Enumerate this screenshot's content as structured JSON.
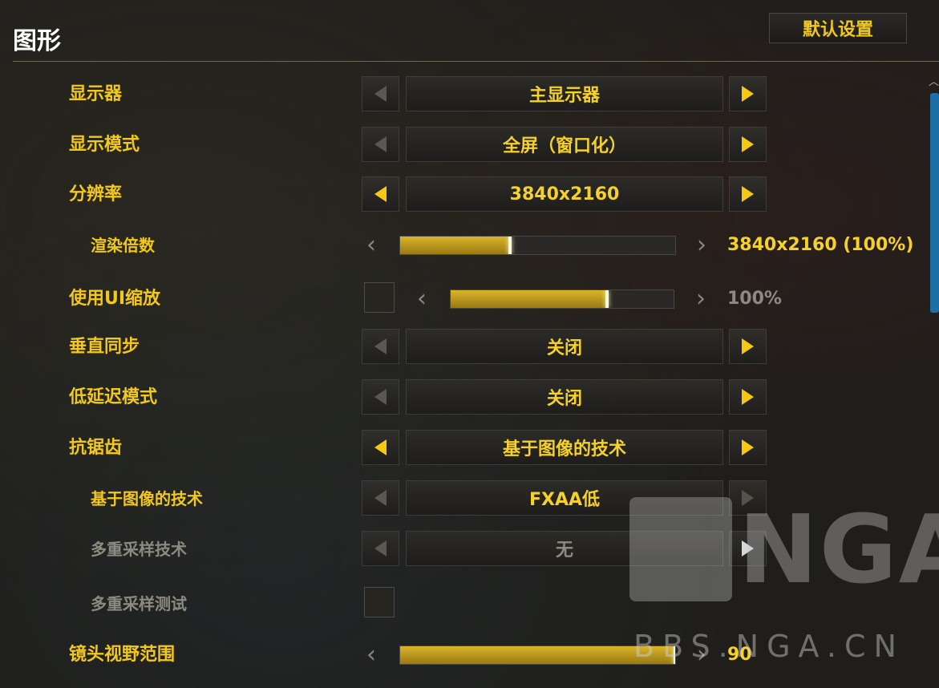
{
  "header": {
    "title": "图形",
    "default_button": "默认设置"
  },
  "settings": {
    "monitor": {
      "label": "显示器",
      "value": "主显示器"
    },
    "display_mode": {
      "label": "显示模式",
      "value": "全屏（窗口化）"
    },
    "resolution": {
      "label": "分辨率",
      "value": "3840x2160"
    },
    "render_scale": {
      "label": "渲染倍数",
      "value_text": "3840x2160 (100%)",
      "fill_fraction": 0.4
    },
    "ui_scale": {
      "label": "使用UI缩放",
      "value_text": "100%",
      "fill_fraction": 0.7,
      "checked": false
    },
    "vsync": {
      "label": "垂直同步",
      "value": "关闭"
    },
    "low_latency": {
      "label": "低延迟模式",
      "value": "关闭"
    },
    "anti_aliasing": {
      "label": "抗锯齿",
      "value": "基于图像的技术"
    },
    "image_based": {
      "label": "基于图像的技术",
      "value": "FXAA低"
    },
    "multisample": {
      "label": "多重采样技术",
      "value": "无"
    },
    "multisample_test": {
      "label": "多重采样测试",
      "checked": false
    },
    "fov": {
      "label": "镜头视野范围",
      "value_text": "90",
      "fill_fraction": 1.0
    }
  },
  "watermark": {
    "brand": "NGA",
    "url": "BBS.NGA.CN"
  },
  "icons": {
    "arrow_left": "triangle-left",
    "arrow_right": "triangle-right",
    "chevron_left": "chevron-left",
    "chevron_right": "chevron-right",
    "scroll_up": "caret-up"
  },
  "colors": {
    "accent": "#f2c81c",
    "disabled": "#8d8a80",
    "scroll_thumb": "#1d6fa8",
    "title": "#ffffff"
  }
}
